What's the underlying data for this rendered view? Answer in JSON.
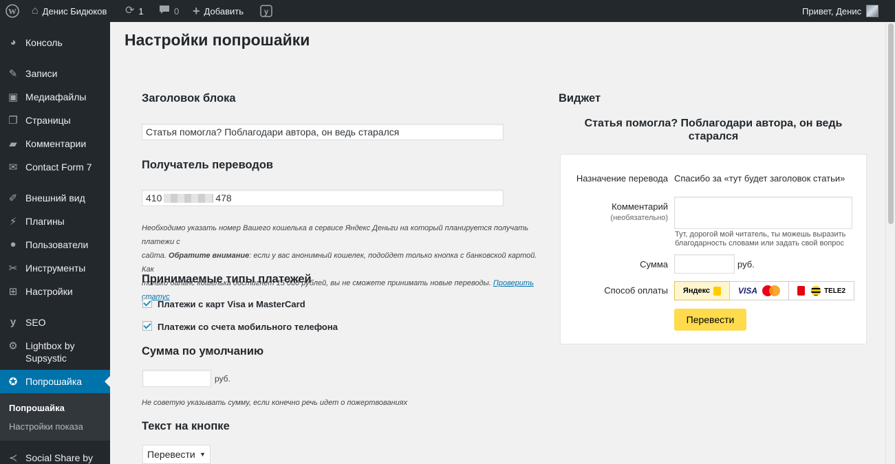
{
  "adminbar": {
    "wp_icon": "wordpress-icon",
    "site_name": "Денис Бидюков",
    "updates_count": "1",
    "comments_count": "0",
    "add_new_label": "Добавить",
    "greeting": "Привет, Денис"
  },
  "sidebar": {
    "items": [
      {
        "label": "Консоль",
        "icon": "dashboard-icon"
      },
      {
        "label": "Записи",
        "icon": "pin-icon"
      },
      {
        "label": "Медиафайлы",
        "icon": "media-icon"
      },
      {
        "label": "Страницы",
        "icon": "pages-icon"
      },
      {
        "label": "Комментарии",
        "icon": "comments-icon"
      },
      {
        "label": "Contact Form 7",
        "icon": "mail-icon"
      },
      {
        "label": "Внешний вид",
        "icon": "brush-icon"
      },
      {
        "label": "Плагины",
        "icon": "plugin-icon"
      },
      {
        "label": "Пользователи",
        "icon": "users-icon"
      },
      {
        "label": "Инструменты",
        "icon": "tools-icon"
      },
      {
        "label": "Настройки",
        "icon": "settings-icon"
      },
      {
        "label": "SEO",
        "icon": "yoast-icon"
      },
      {
        "label": "Lightbox by Supsystic",
        "icon": "gear-icon"
      },
      {
        "label": "Попрошайка",
        "icon": "lifebuoy-icon"
      },
      {
        "label": "Social Share by Supsystic",
        "icon": "share-icon"
      }
    ],
    "submenu": [
      "Попрошайка",
      "Настройки показа"
    ]
  },
  "page": {
    "title": "Настройки попрошайки",
    "block_title_heading": "Заголовок блока",
    "block_title_value": "Статья помогла? Поблагодари автора, он ведь старался",
    "recipient_heading": "Получатель переводов",
    "recipient_prefix": "410",
    "recipient_suffix": "478",
    "desc_line1": "Необходимо указать номер Вашего кошелька в сервисе Яндекс Деньги на который планируется получать платежи с",
    "desc_line2_a": "сайта. ",
    "desc_line2_b": "Обратите внимание",
    "desc_line2_c": ": если у вас анонимный кошелек, подойдет только кнопка с банковской картой. Как",
    "desc_line3": "только баланс кошелька достигнет 15 000 рублей, вы не сможете принимать новые переводы. ",
    "desc_link": "Проверить статус",
    "payment_types_heading": "Принимаемые типы платежей",
    "cb1_label": "Платежи с карт Visa и MasterCard",
    "cb2_label": "Платежи со счета мобильного телефона",
    "default_sum_heading": "Сумма по умолчанию",
    "sum_value": "",
    "rub": "руб.",
    "sum_note": "Не советую указывать сумму, если конечно речь идет о пожертвованиях",
    "button_text_heading": "Текст на кнопке",
    "button_text_value": "Перевести"
  },
  "widget": {
    "heading": "Виджет",
    "title_line1": "Статья помогла? Поблагодари автора, он ведь",
    "title_line2": "старался",
    "purpose_label": "Назначение перевода",
    "purpose_value": "Спасибо за «тут будет заголовок статьи»",
    "comment_label": "Комментарий",
    "comment_optional": "(необязательно)",
    "comment_value": "",
    "comment_hint_line1": "Тут, дорогой мой читатель, ты можешь выразить",
    "comment_hint_line2": "благодарность словами или задать свой вопрос",
    "sum_label": "Сумма",
    "sum_value": "",
    "rub": "руб.",
    "method_label": "Способ оплаты",
    "yandex_label": "Яндекс",
    "visa_label": "VISA",
    "mastercard_label": "MasterCard",
    "tele2_label": "TELE2",
    "submit_label": "Перевести",
    "colors": {
      "yandex_bg": "#fdf6d0",
      "button": "#ffdb4d",
      "visa": "#1a1f71",
      "mc_red": "#eb001b",
      "mc_orange": "#f79e1b",
      "mts": "#e30611",
      "beeline": "#ffcc00"
    }
  },
  "colors": {
    "adminbar": "#23282d",
    "sidebar": "#23282d",
    "active": "#0073aa",
    "link": "#0073aa",
    "checkbox": "#1e8cbe"
  }
}
